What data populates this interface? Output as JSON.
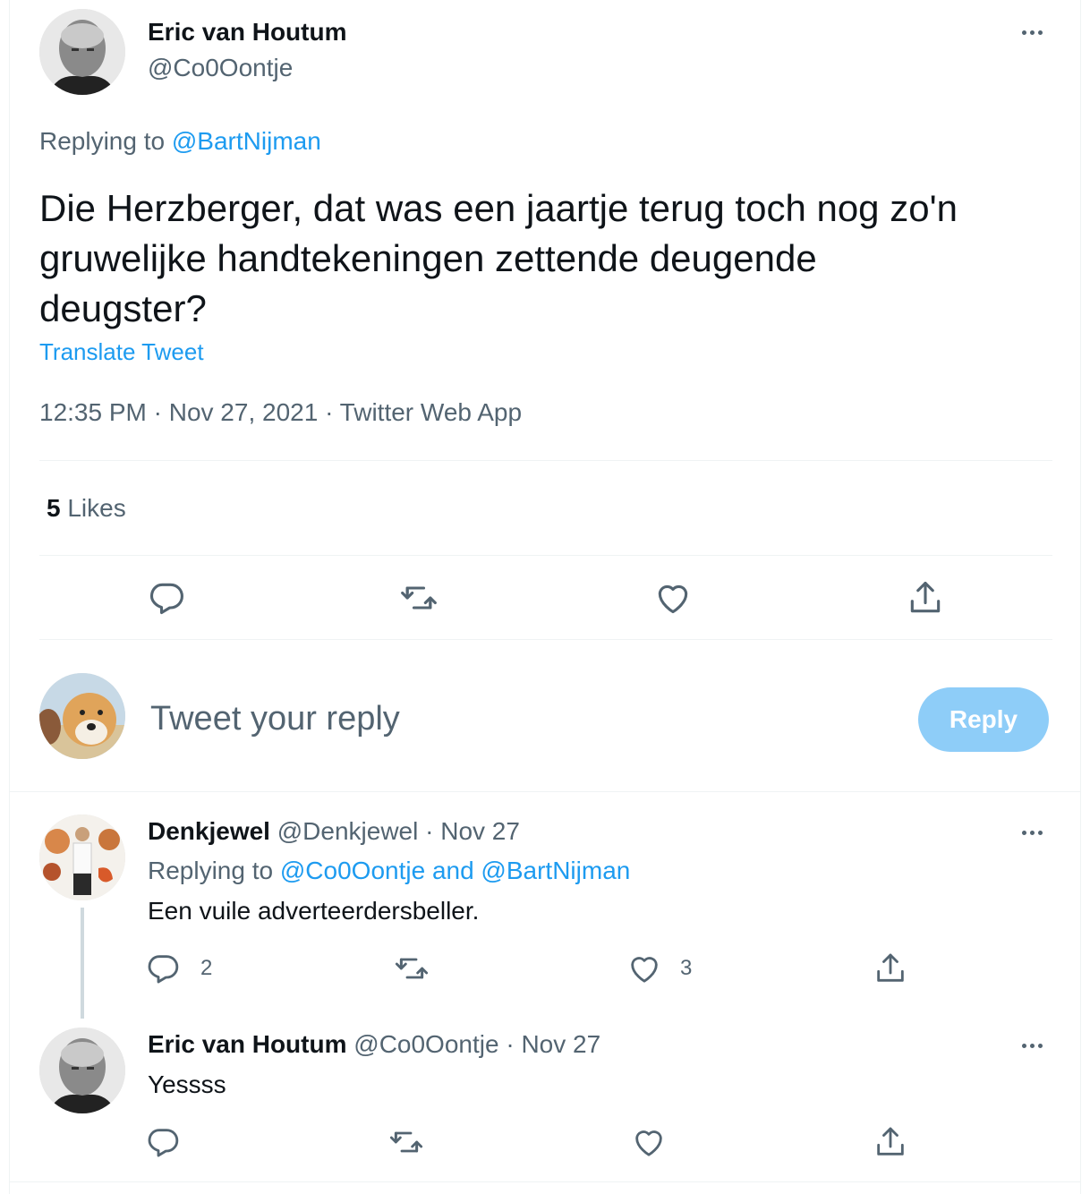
{
  "main_tweet": {
    "author_name": "Eric van Houtum",
    "author_handle": "@Co0Oontje",
    "replying_prefix": "Replying to",
    "replying_to": "@BartNijman",
    "text_line1": "Die Herzberger, dat was een jaartje terug toch nog zo'n",
    "text_line2": "gruwelijke handtekeningen zettende deugende",
    "text_line3": "deugster?",
    "translate_label": "Translate Tweet",
    "timestamp": "12:35 PM · Nov 27, 2021 · Twitter Web App",
    "likes_count": "5",
    "likes_label": "Likes"
  },
  "composer": {
    "placeholder": "Tweet your reply",
    "reply_button": "Reply"
  },
  "replies": [
    {
      "author_name": "Denkjewel",
      "author_handle": "@Denkjewel",
      "date": "· Nov 27",
      "replying_prefix": "Replying to",
      "replying_to": "@Co0Oontje and @BartNijman",
      "text": "Een vuile adverteerdersbeller.",
      "reply_count": "2",
      "like_count": "3"
    },
    {
      "author_name": "Eric van Houtum",
      "author_handle": "@Co0Oontje",
      "date": "· Nov 27",
      "text": "Yessss"
    }
  ],
  "colors": {
    "accent": "#1d9bf0",
    "reply_button_disabled": "#8ecdf8",
    "secondary_text": "#536471",
    "divider": "#eff3f4"
  },
  "icons": [
    "more-icon",
    "reply-icon",
    "retweet-icon",
    "like-icon",
    "share-icon"
  ]
}
